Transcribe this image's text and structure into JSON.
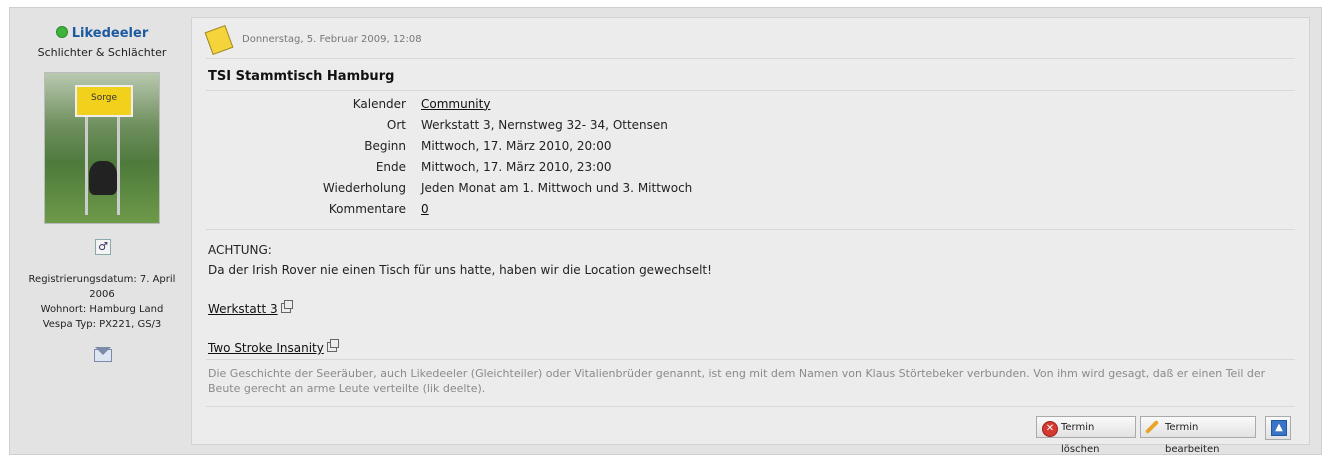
{
  "user": {
    "name": "Likedeeler",
    "title": "Schlichter & Schlächter",
    "avatar_sign_text": "Sorge",
    "registration": "Registrierungsdatum: 7. April 2006",
    "location": "Wohnort: Hamburg Land",
    "vespa": "Vespa Typ: PX221, GS/3",
    "status_color": "#3cb43c"
  },
  "post": {
    "date": "Donnerstag, 5. Februar 2009, 12:08",
    "title": "TSI Stammtisch Hamburg",
    "details": [
      {
        "label": "Kalender",
        "value": "Community"
      },
      {
        "label": "Ort",
        "value": "Werkstatt 3, Nernstweg 32- 34, Ottensen"
      },
      {
        "label": "Beginn",
        "value": "Mittwoch, 17. März 2010, 20:00"
      },
      {
        "label": "Ende",
        "value": "Mittwoch, 17. März 2010, 23:00"
      },
      {
        "label": "Wiederholung",
        "value": "Jeden Monat am 1. Mittwoch und 3. Mittwoch"
      },
      {
        "label": "Kommentare",
        "value": "0"
      }
    ],
    "body_line1": "ACHTUNG:",
    "body_line2": "Da der Irish Rover nie einen Tisch für uns hatte, haben wir die Location gewechselt!",
    "link1": "Werkstatt 3",
    "link2": "Two Stroke Insanity",
    "signature": "Die Geschichte der Seeräuber, auch Likedeeler (Gleichteiler) oder Vitalienbrüder genannt, ist eng mit dem Namen von Klaus Störtebeker verbunden. Von ihm wird gesagt, daß er einen Teil der Beute gerecht an arme Leute verteilte (lik deelte).",
    "buttons": {
      "delete": "Termin löschen",
      "edit": "Termin bearbeiten"
    }
  }
}
